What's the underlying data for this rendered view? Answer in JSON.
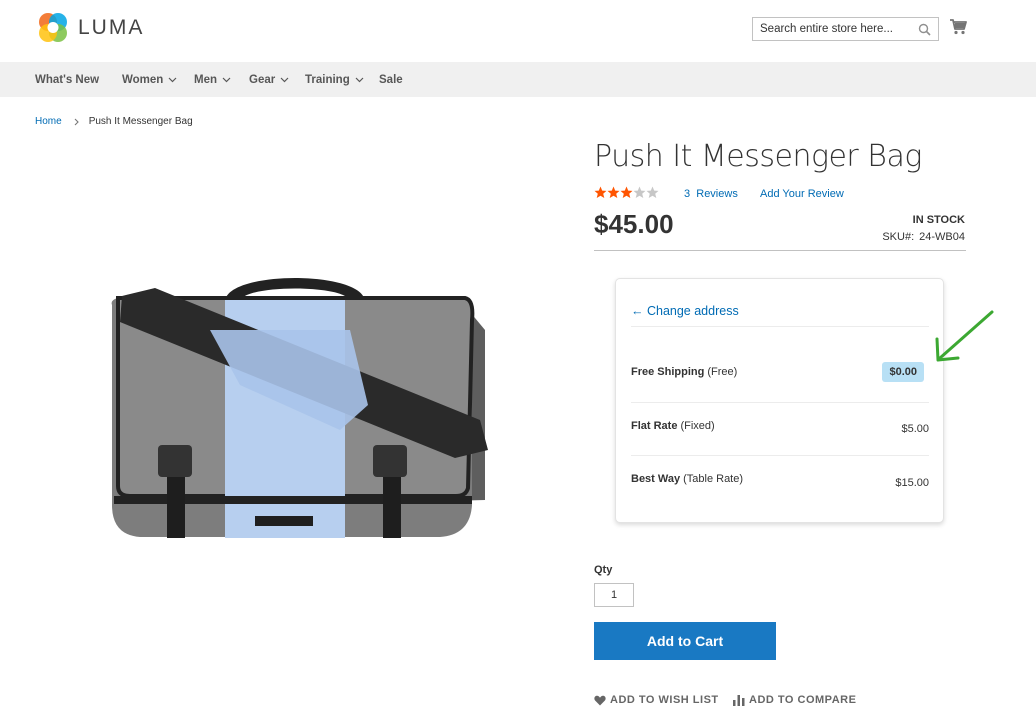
{
  "header": {
    "logo_text": "LUMA",
    "search_placeholder": "Search entire store here..."
  },
  "nav": {
    "items": [
      {
        "label": "What's New",
        "has_dropdown": false
      },
      {
        "label": "Women",
        "has_dropdown": true
      },
      {
        "label": "Men",
        "has_dropdown": true
      },
      {
        "label": "Gear",
        "has_dropdown": true
      },
      {
        "label": "Training",
        "has_dropdown": true
      },
      {
        "label": "Sale",
        "has_dropdown": false
      }
    ]
  },
  "breadcrumb": {
    "home": "Home",
    "current": "Push It Messenger Bag"
  },
  "product": {
    "name": "Push It Messenger Bag",
    "rating_stars": 3.5,
    "rating_max": 5,
    "reviews_count": "3",
    "reviews_label": "Reviews",
    "add_review": "Add Your Review",
    "price": "$45.00",
    "stock": "IN STOCK",
    "sku_label": "SKU#:",
    "sku": "24-WB04"
  },
  "shipping": {
    "change_address": "← Change address",
    "options": [
      {
        "method": "Free Shipping",
        "carrier": "(Free)",
        "amount": "$0.00",
        "highlighted": true
      },
      {
        "method": "Flat Rate",
        "carrier": "(Fixed)",
        "amount": "$5.00",
        "highlighted": false
      },
      {
        "method": "Best Way",
        "carrier": "(Table Rate)",
        "amount": "$15.00",
        "highlighted": false
      }
    ]
  },
  "cart": {
    "qty_label": "Qty",
    "qty_value": "1",
    "add_to_cart": "Add to Cart",
    "wishlist": "ADD TO WISH LIST",
    "compare": "ADD TO COMPARE"
  },
  "colors": {
    "primary_button": "#1979c3",
    "link": "#006bb4",
    "star": "#ff5501",
    "badge_bg": "#b8e0f5",
    "annotation_arrow": "#3ca832"
  }
}
